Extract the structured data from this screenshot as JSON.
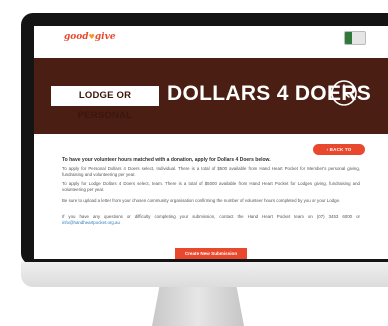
{
  "brand": {
    "logo_text": "good",
    "logo_heart": "♥",
    "logo_text2": "give"
  },
  "hero": {
    "badge": "LODGE OR PERSONAL",
    "title": "DOLLARS 4 DOERS",
    "background": "#4a1e12"
  },
  "content": {
    "back_button": "‹ BACK TO CHARITIES",
    "intro": "To have your volunteer hours matched with a donation, apply for Dollars 4 Doers below.",
    "paragraph_1": "To apply for Personal Dollars 4 Doers select, Individual. There is a total of $500 available from Hand Heart Pocket for Member's personal giving, fundraising and volunteering per year.",
    "paragraph_2": "To apply for Lodge Dollars 4 Doers select, team. There is a total of $5000 available from Hand Heart Pocket for Lodges giving, fundraising and volunteering per year.",
    "paragraph_3": "Be sure to upload a letter from your chosen community organisation confirming the number of volunteer hours completed by you or your Lodge.",
    "paragraph_4": "If you have any questions or difficulty completing your submission, contact the Hand Heart Pocket team on (07) 3453 6000 or",
    "email": "info@handheartpocket.org.au",
    "create_button": "Create New Submission"
  },
  "colors": {
    "accent": "#e8492e",
    "hero": "#4a1e12"
  }
}
